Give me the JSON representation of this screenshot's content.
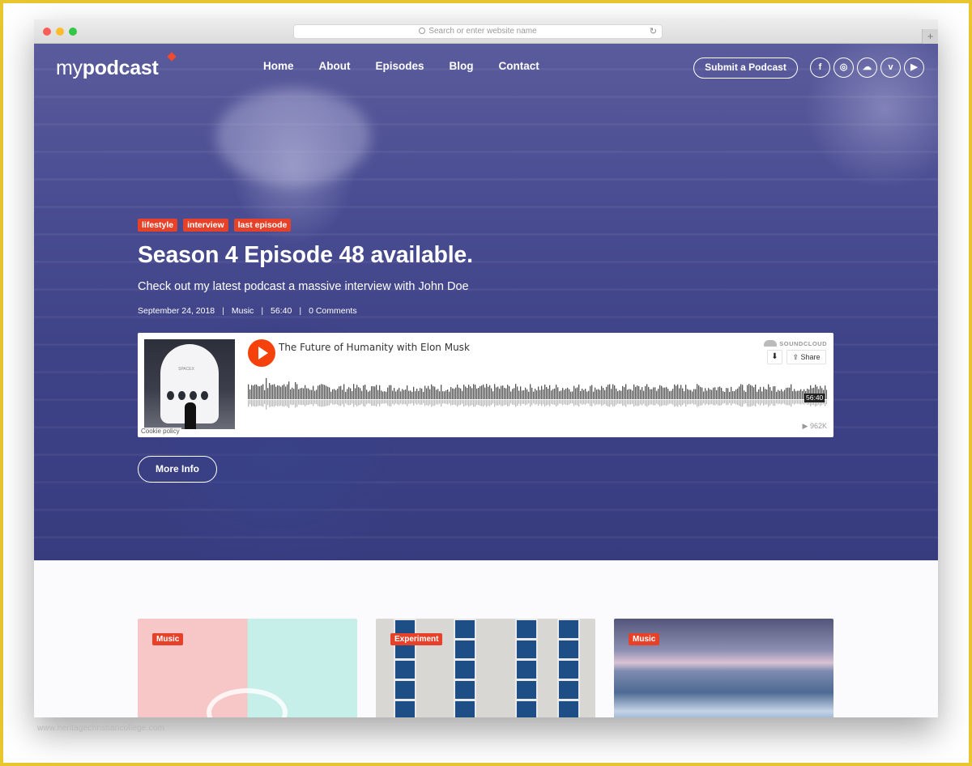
{
  "browser": {
    "address_placeholder": "Search or enter website name",
    "reload_icon": "reload-icon",
    "new_tab": "+"
  },
  "header": {
    "logo_light": "my",
    "logo_bold": "podcast",
    "nav": [
      "Home",
      "About",
      "Episodes",
      "Blog",
      "Contact"
    ],
    "submit_label": "Submit a Podcast",
    "socials": [
      {
        "icon": "facebook-icon",
        "glyph": "f"
      },
      {
        "icon": "instagram-icon",
        "glyph": "◎"
      },
      {
        "icon": "soundcloud-icon",
        "glyph": "☁"
      },
      {
        "icon": "vimeo-icon",
        "glyph": "v"
      },
      {
        "icon": "youtube-icon",
        "glyph": "▶"
      }
    ]
  },
  "hero": {
    "tags": [
      "lifestyle",
      "interview",
      "last episode"
    ],
    "title": "Season 4 Episode 48 available.",
    "subtitle": "Check out my latest podcast a massive interview with John Doe",
    "meta": {
      "date": "September 24, 2018",
      "category": "Music",
      "duration": "56:40",
      "comments": "0 Comments"
    },
    "more_label": "More Info"
  },
  "player": {
    "track_title": "The Future of Humanity with Elon Musk",
    "brand": "SOUNDCLOUD",
    "share_label": "Share",
    "download_glyph": "⬇",
    "time": "56:40",
    "plays": "▶ 962K",
    "cookie_label": "Cookie policy",
    "artwork_text": "SPACEX"
  },
  "cards": [
    {
      "tag": "Music"
    },
    {
      "tag": "Experiment"
    },
    {
      "tag": "Music"
    }
  ],
  "watermark": "www.heritagechristiancollege.com",
  "colors": {
    "accent": "#e6422a",
    "play": "#f5410b",
    "hero_overlay": "#3e4287",
    "frame": "#e8c630"
  }
}
